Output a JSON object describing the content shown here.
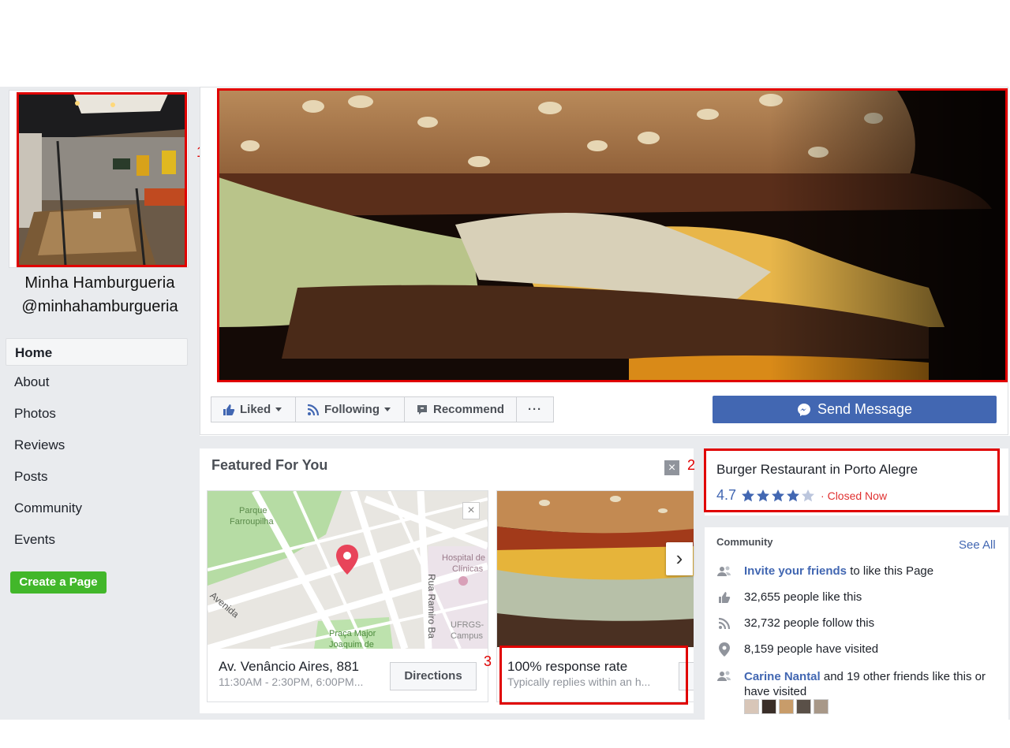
{
  "page": {
    "name": "Minha Hamburgueria",
    "handle": "@minhahamburgueria"
  },
  "nav": {
    "items": [
      {
        "label": "Home",
        "active": true
      },
      {
        "label": "About"
      },
      {
        "label": "Photos"
      },
      {
        "label": "Reviews"
      },
      {
        "label": "Posts"
      },
      {
        "label": "Community"
      },
      {
        "label": "Events"
      }
    ],
    "create_page": "Create a Page"
  },
  "actions": {
    "liked": "Liked",
    "following": "Following",
    "recommend": "Recommend",
    "more": "···",
    "send_message": "Send Message"
  },
  "featured": {
    "title": "Featured For You",
    "close": "×",
    "map": {
      "labels": {
        "park": "Parque\nFarroupilha",
        "hospital": "Hospital de\nClínicas",
        "ufrgs": "UFRGS-\nCampus\nSaúde",
        "praca": "Praça Major\nJoaquim de",
        "avenida": "Avenida",
        "rua": "Rua Ramiro Ba",
        "jo": "Jo"
      },
      "address": "Av. Venâncio Aires, 881",
      "hours": "11:30AM - 2:30PM, 6:00PM...",
      "directions": "Directions"
    },
    "response": {
      "title": "100% response rate",
      "subtitle": "Typically replies within an h..."
    }
  },
  "about": {
    "category": "Burger Restaurant in Porto Alegre",
    "rating": "4.7",
    "rating_value": 4.7,
    "status": "· Closed Now"
  },
  "community": {
    "title": "Community",
    "see_all": "See All",
    "invite_link": "Invite your friends",
    "invite_rest": " to like this Page",
    "likes": "32,655 people like this",
    "follows": "32,732 people follow this",
    "visited": "8,159 people have visited",
    "friend_name": "Carine Nantal",
    "friend_rest": " and 19 other friends like this or have visited"
  },
  "annotations": [
    "1",
    "2",
    "3"
  ],
  "colors": {
    "accent": "#4267b2",
    "green": "#42b72a",
    "annotation_red": "#e00000",
    "closed_red": "#e03030"
  }
}
